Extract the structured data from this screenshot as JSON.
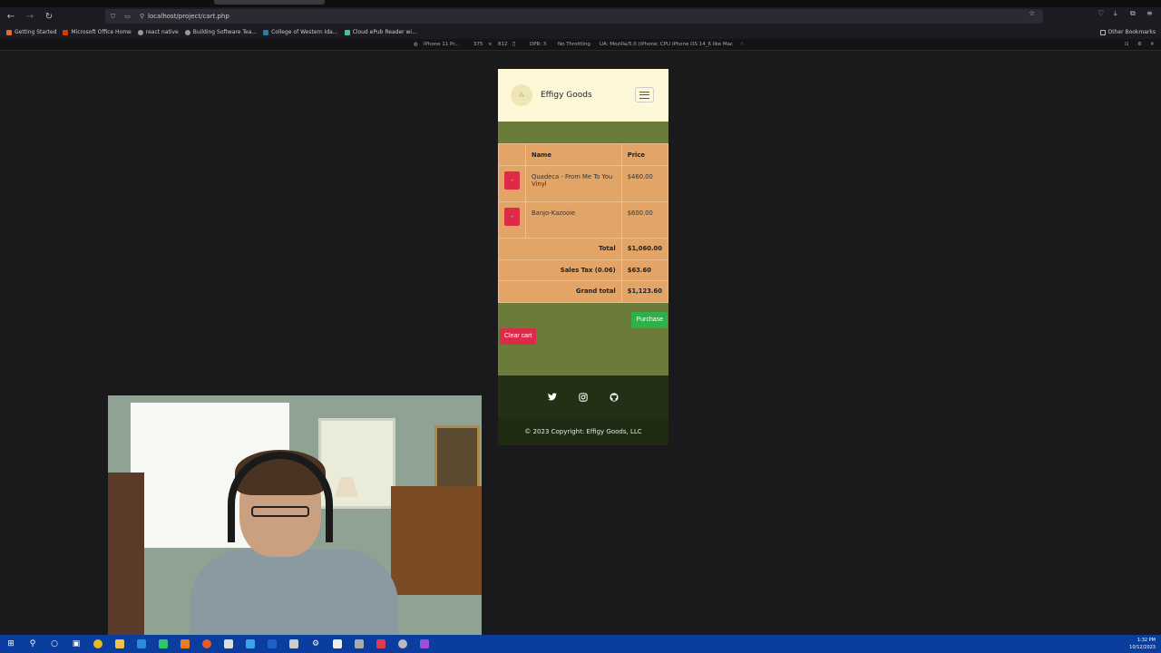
{
  "browser": {
    "url": "localhost/project/cart.php",
    "bookmarks": [
      "Getting Started",
      "Microsoft Office Home",
      "react native",
      "Building Software Tea...",
      "College of Western Ida...",
      "Cloud ePub Reader wi..."
    ],
    "other_bookmarks": "Other Bookmarks"
  },
  "devtools": {
    "device": "iPhone 11 Pr...",
    "width": "375",
    "x": "×",
    "height": "812",
    "dpr": "DPR: 3",
    "throttling": "No Throttling",
    "ua": "UA: Mozilla/5.0 (iPhone; CPU iPhone OS 14_6 like Mac"
  },
  "site": {
    "brand": "Effigy Goods",
    "table": {
      "headers": [
        "",
        "Name",
        "Price"
      ],
      "rows": [
        {
          "remove": "-",
          "name": "Quadeca - From Me To You Vinyl",
          "price": "$460.00"
        },
        {
          "remove": "-",
          "name": "Banjo-Kazooie",
          "price": "$600.00"
        }
      ],
      "total_label": "Total",
      "total_value": "$1,060.00",
      "tax_label": "Sales Tax (0.06)",
      "tax_value": "$63.60",
      "grand_label": "Grand total",
      "grand_value": "$1,123.60"
    },
    "purchase_label": "Purchase",
    "clear_label": "Clear cart",
    "copyright": "© 2023 Copyright: Effigy Goods, LLC"
  },
  "taskbar": {
    "time": "1:32 PM",
    "date": "10/12/2023"
  }
}
